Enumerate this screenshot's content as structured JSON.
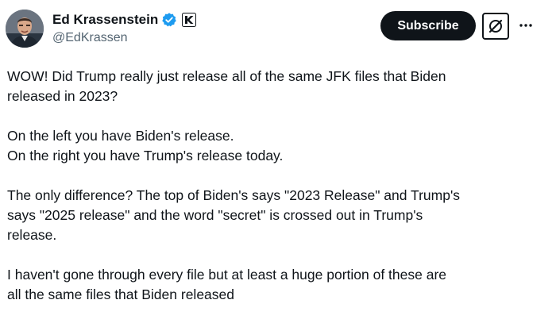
{
  "author": {
    "display_name": "Ed Krassenstein",
    "handle": "@EdKrassen"
  },
  "icons": {
    "verified": "verified-badge-icon",
    "affiliate": "affiliate-badge-icon",
    "grok": "grok-icon",
    "more": "more-dots-icon"
  },
  "colors": {
    "verified_blue": "#1d9bf0",
    "subscribe_bg": "#0f1419",
    "text_primary": "#0f1419",
    "text_secondary": "#536471"
  },
  "actions": {
    "subscribe_label": "Subscribe",
    "more_label": "···"
  },
  "tweet": {
    "paragraphs": [
      {
        "lines": [
          "WOW! Did Trump really just release all of the same JFK files that Biden",
          "released in 2023?"
        ]
      },
      {
        "lines": [
          "On the left you have Biden's release.",
          "On the right you have Trump's release today."
        ]
      },
      {
        "lines": [
          "The only difference? The top of Biden's says \"2023 Release\" and Trump's",
          "says \"2025 release\" and the word \"secret\" is crossed out in Trump's",
          "release."
        ]
      },
      {
        "lines": [
          "I haven't gone through every file but at least a huge portion of these are",
          "all the same files that Biden released"
        ]
      }
    ]
  }
}
